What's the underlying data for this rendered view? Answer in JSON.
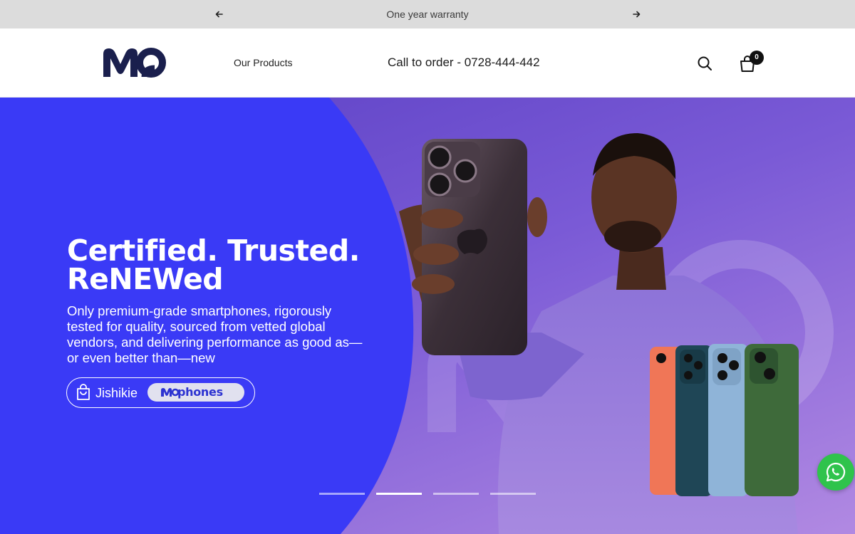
{
  "announcement": {
    "message": "One year warranty",
    "prev_icon": "arrow-left-icon",
    "next_icon": "arrow-right-icon"
  },
  "header": {
    "logo_icon": "mophones-logo-icon",
    "nav_link": "Our Products",
    "call_text": "Call to order - 0728-444-442",
    "search_icon": "search-icon",
    "cart_icon": "cart-bag-icon",
    "cart_count": "0"
  },
  "hero": {
    "headline_line1": "Certified. Trusted.",
    "headline_line2": "ReNEWed",
    "subtext": "Only premium-grade smartphones, rigorously tested for quality, sourced from vetted global vendors, and delivering performance as good as—or even better than—new",
    "cta_label": "Jishikie",
    "cta_brand": "phones",
    "cta_brand_logo": "mo-logo-icon",
    "cta_icon": "shopping-bag-icon",
    "slide_count": 4,
    "active_slide": 2
  },
  "colors": {
    "hero_blue": "#3a3af6",
    "hero_purple": "#6e4fd0",
    "brand_navy": "#1a1f4d",
    "whatsapp_green": "#2fc34c"
  },
  "whatsapp": {
    "icon": "whatsapp-icon"
  }
}
